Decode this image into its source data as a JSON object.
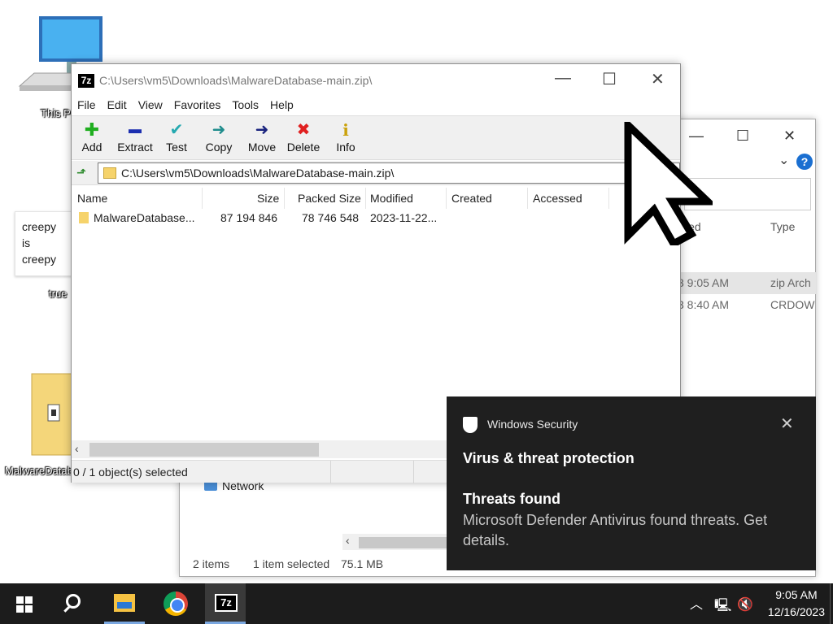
{
  "desktop": {
    "this_pc_label": "This PC",
    "note_text": "creepy is creepy",
    "true_label": "true",
    "malware_label": "MalwareDatabase"
  },
  "explorer": {
    "columns": {
      "modified": "ied",
      "type": "Type"
    },
    "rows": [
      {
        "modified": "3 9:05 AM",
        "type": "zip Arch"
      },
      {
        "modified": "3 8:40 AM",
        "type": "CRDOW"
      }
    ],
    "nav_network": "Network",
    "status": {
      "count": "2 items",
      "selected": "1 item selected",
      "size": "75.1 MB"
    },
    "help_glyph": "?"
  },
  "sevenzip": {
    "logo": "7z",
    "title": "C:\\Users\\vm5\\Downloads\\MalwareDatabase-main.zip\\",
    "menu": [
      "File",
      "Edit",
      "View",
      "Favorites",
      "Tools",
      "Help"
    ],
    "toolbar": [
      {
        "label": "Add",
        "icon": "plus-icon",
        "glyph": "✚",
        "color": "#1fae1f"
      },
      {
        "label": "Extract",
        "icon": "minus-icon",
        "glyph": "▬",
        "color": "#1c2fb0"
      },
      {
        "label": "Test",
        "icon": "check-icon",
        "glyph": "✔",
        "color": "#25a9b0"
      },
      {
        "label": "Copy",
        "icon": "copy-arrow-icon",
        "glyph": "➜",
        "color": "#1f8c8c"
      },
      {
        "label": "Move",
        "icon": "move-arrow-icon",
        "glyph": "➜",
        "color": "#1a237e"
      },
      {
        "label": "Delete",
        "icon": "delete-icon",
        "glyph": "✖",
        "color": "#e02020"
      },
      {
        "label": "Info",
        "icon": "info-icon",
        "glyph": "i",
        "color": "#caa10a"
      }
    ],
    "address": "C:\\Users\\vm5\\Downloads\\MalwareDatabase-main.zip\\",
    "columns": [
      "Name",
      "Size",
      "Packed Size",
      "Modified",
      "Created",
      "Accessed"
    ],
    "rows": [
      {
        "name": "MalwareDatabase...",
        "size": "87 194 846",
        "packed": "78 746 548",
        "modified": "2023-11-22...",
        "created": "",
        "accessed": ""
      }
    ],
    "status": "0 / 1 object(s) selected"
  },
  "toast": {
    "app": "Windows Security",
    "title": "Virus & threat protection",
    "heading": "Threats found",
    "body": "Microsoft Defender Antivirus found threats. Get details."
  },
  "taskbar": {
    "time": "9:05 AM",
    "date": "12/16/2023",
    "seven_zip_label": "7z"
  },
  "colors": {
    "toast_bg": "#1f1f1f",
    "taskbar_bg": "#1c1c1c",
    "accent": "#1a6fd1"
  }
}
